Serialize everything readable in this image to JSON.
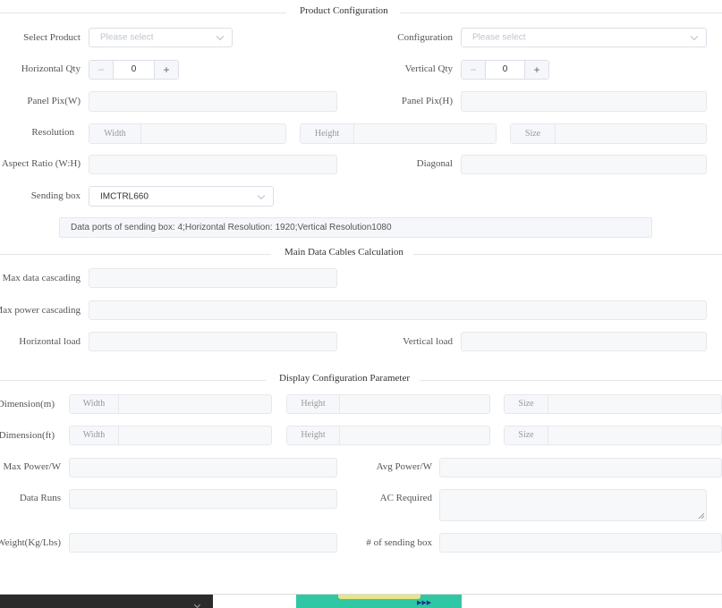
{
  "sections": {
    "product": "Product Configuration",
    "cables": "Main Data Cables Calculation",
    "display": "Display Configuration Parameter"
  },
  "product": {
    "select_product_label": "Select Product",
    "select_product_placeholder": "Please select",
    "configuration_label": "Configuration",
    "configuration_placeholder": "Please select",
    "h_qty_label": "Horizontal Qty",
    "h_qty_value": "0",
    "v_qty_label": "Vertical Qty",
    "v_qty_value": "0",
    "minus_glyph": "−",
    "plus_glyph": "+",
    "panel_pix_w_label": "Panel Pix(W)",
    "panel_pix_h_label": "Panel Pix(H)",
    "resolution_label": "Resolution",
    "width_label": "Width",
    "height_label": "Height",
    "size_label": "Size",
    "aspect_ratio_label": "Aspect Ratio (W:H)",
    "diagonal_label": "Diagonal",
    "sending_box_label": "Sending box",
    "sending_box_value": "IMCTRL660",
    "info_text": "Data ports of sending box:  4;Horizontal Resolution:  1920;Vertical Resolution1080"
  },
  "cables": {
    "max_data_label": "Max data cascading",
    "max_power_label": "Max power cascading",
    "horizontal_load_label": "Horizontal load",
    "vertical_load_label": "Vertical load"
  },
  "display": {
    "dimension_m_label": "Dimension(m)",
    "dimension_ft_label": "Dimension(ft)",
    "width_label": "Width",
    "height_label": "Height",
    "size_label": "Size",
    "max_power_label": "Max Power/W",
    "avg_power_label": "Avg Power/W",
    "data_runs_label": "Data Runs",
    "ac_required_label": "AC Required",
    "weight_label": "Weight(Kg/Lbs)",
    "sending_box_count_label": "# of sending box"
  }
}
